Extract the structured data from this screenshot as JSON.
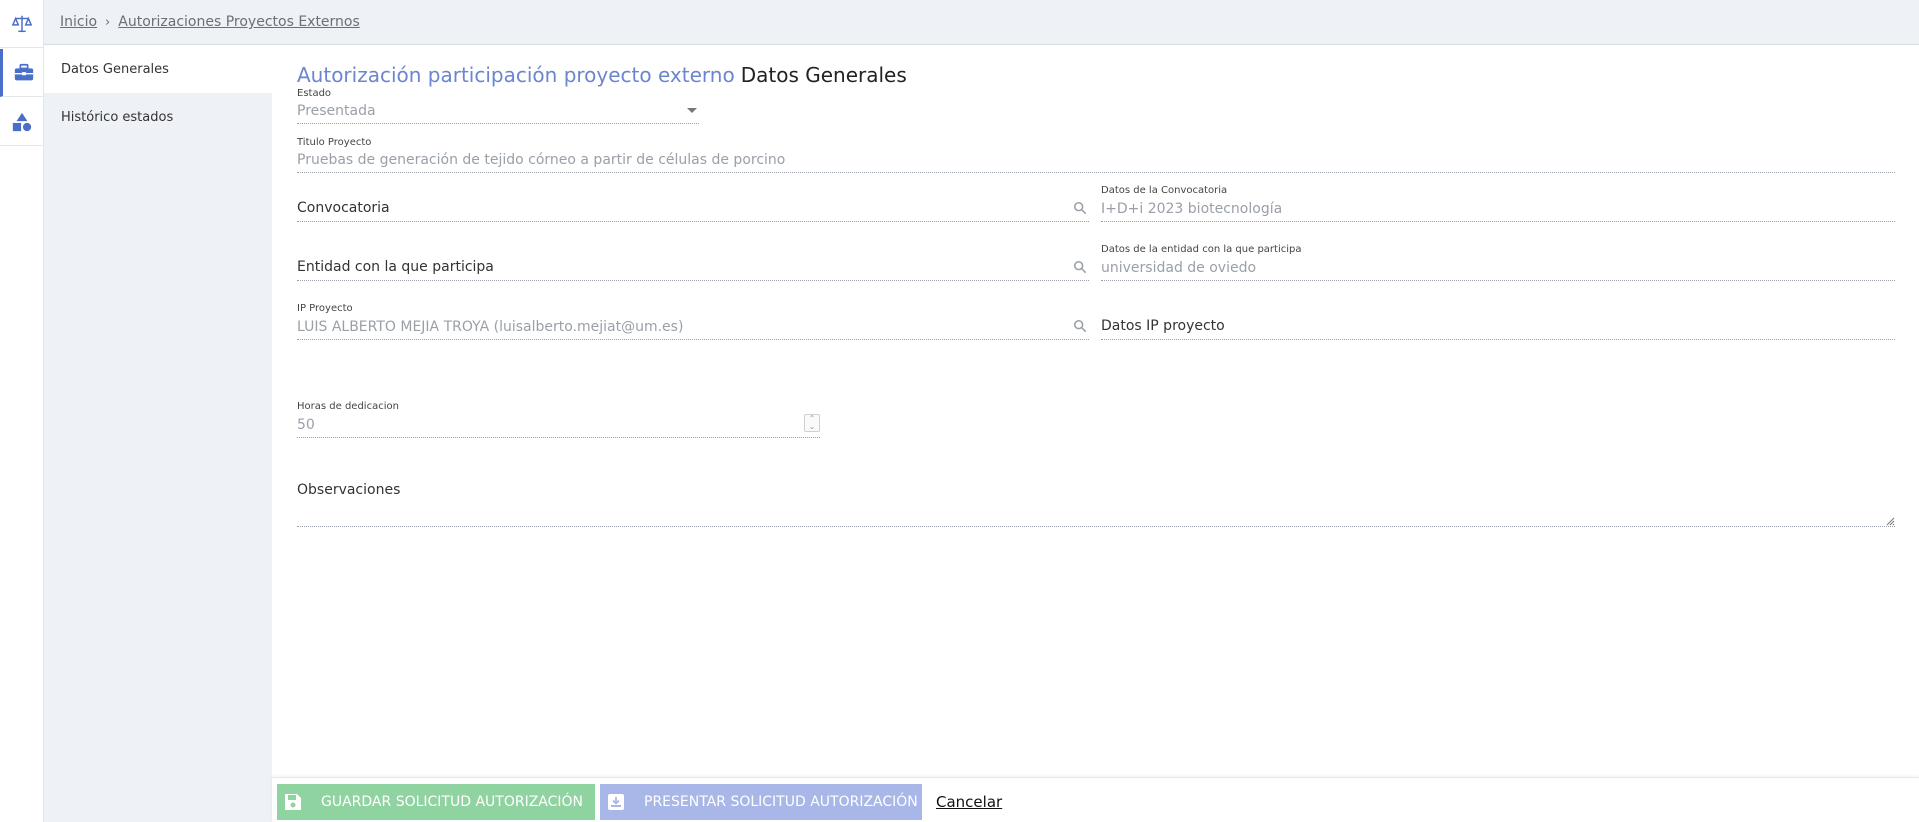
{
  "rail": {
    "icons": [
      "scales-icon",
      "briefcase-icon",
      "shapes-icon"
    ]
  },
  "breadcrumb": {
    "home": "Inicio",
    "separator": ">",
    "current": "Autorizaciones Proyectos Externos"
  },
  "sidebar": {
    "items": [
      {
        "label": "Datos Generales",
        "active": true
      },
      {
        "label": "Histórico estados",
        "active": false
      }
    ]
  },
  "main": {
    "title_section": "Autorización participación proyecto externo",
    "title_page": "Datos Generales",
    "estado": {
      "label": "Estado",
      "value": "Presentada"
    },
    "titulo_proyecto": {
      "label": "Titulo Proyecto",
      "value": "Pruebas de generación de tejido córneo a partir de células de porcino"
    },
    "convocatoria": {
      "placeholder": "Convocatoria"
    },
    "datos_convocatoria": {
      "label": "Datos de la Convocatoria",
      "value": "I+D+i 2023 biotecnología"
    },
    "entidad": {
      "placeholder": "Entidad con la que participa"
    },
    "datos_entidad": {
      "label": "Datos de la entidad con la que participa",
      "value": "universidad de oviedo"
    },
    "ip_proyecto": {
      "label": "IP Proyecto",
      "value": "LUIS ALBERTO MEJIA TROYA (luisalberto.mejiat@um.es)"
    },
    "datos_ip": {
      "placeholder": "Datos IP proyecto"
    },
    "horas": {
      "label": "Horas de dedicacion",
      "value": "50"
    },
    "observaciones": {
      "placeholder": "Observaciones"
    }
  },
  "footer": {
    "save_label": "GUARDAR SOLICITUD AUTORIZACIÓN",
    "present_label": "PRESENTAR SOLICITUD AUTORIZACIÓN",
    "cancel_label": "Cancelar"
  },
  "colors": {
    "accent": "#6b86cf",
    "save_button": "#8fd3a0",
    "present_button": "#a9b7e8",
    "sidebar_bg": "#eef1f5"
  }
}
